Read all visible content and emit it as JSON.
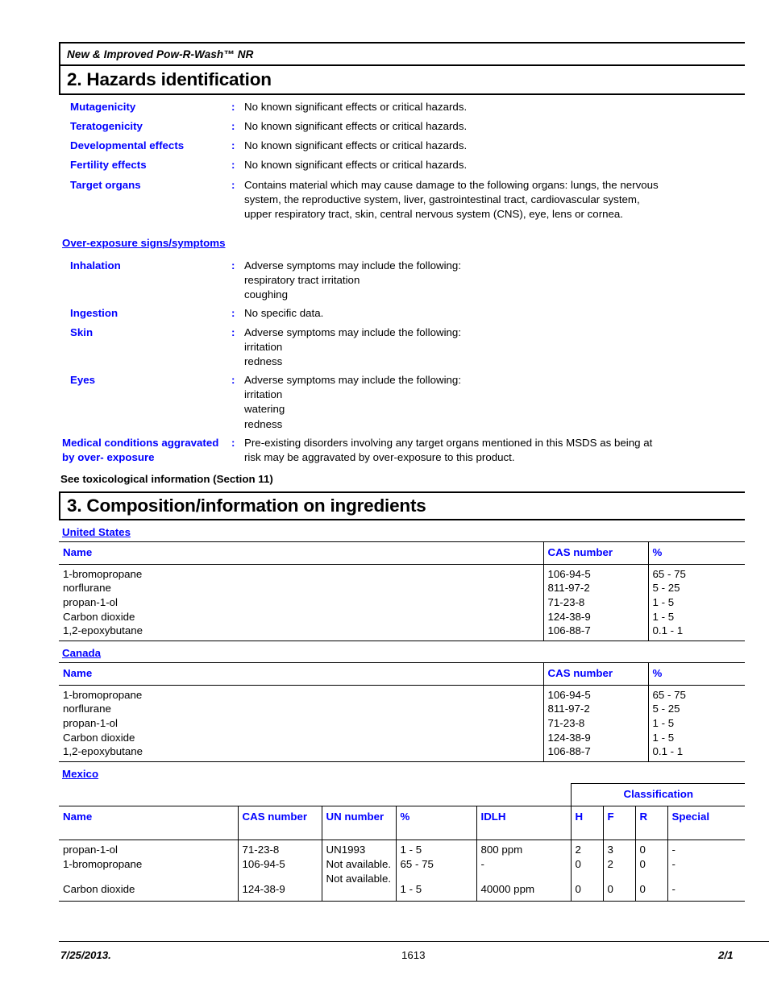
{
  "header": {
    "product_title": "New & Improved Pow-R-Wash™ NR"
  },
  "section2": {
    "title": "2. Hazards identification",
    "colon": ":",
    "rows": [
      {
        "label": "Mutagenicity",
        "lines": [
          "No known significant effects or critical hazards."
        ]
      },
      {
        "label": "Teratogenicity",
        "lines": [
          "No known significant effects or critical hazards."
        ]
      },
      {
        "label": "Developmental effects",
        "lines": [
          "No known significant effects or critical hazards."
        ]
      },
      {
        "label": "Fertility effects",
        "lines": [
          "No known significant effects or critical hazards."
        ]
      },
      {
        "label": "Target organs",
        "lines": [
          "Contains material which may cause damage to the following organs: lungs, the nervous",
          "system, the reproductive system, liver, gastrointestinal tract, cardiovascular system,",
          "upper respiratory tract, skin, central nervous system (CNS), eye, lens or cornea."
        ]
      }
    ],
    "overexposure_heading": "Over-exposure signs/symptoms",
    "overexposure_rows": [
      {
        "label": "Inhalation",
        "lines": [
          "Adverse symptoms may include the following:",
          "respiratory tract irritation",
          "coughing"
        ]
      },
      {
        "label": "Ingestion",
        "lines": [
          "No specific data."
        ]
      },
      {
        "label": "Skin",
        "lines": [
          "Adverse symptoms may include the following:",
          "irritation",
          "redness"
        ]
      },
      {
        "label": "Eyes",
        "lines": [
          "Adverse symptoms may include the following:",
          "irritation",
          "watering",
          "redness"
        ]
      }
    ],
    "medical_label_lines": [
      "Medical conditions",
      "aggravated by over-",
      "exposure"
    ],
    "medical_lines": [
      "Pre-existing disorders involving any target organs mentioned in this MSDS as being at",
      "risk may be aggravated by over-exposure to this product."
    ],
    "tox_note": "See toxicological information (Section 11)"
  },
  "section3": {
    "title": "3. Composition/information on ingredients",
    "us": {
      "heading": "United States",
      "columns": [
        "Name",
        "CAS number",
        "%"
      ],
      "rows": [
        {
          "name": "1-bromopropane",
          "cas": "106-94-5",
          "pct": "65 - 75"
        },
        {
          "name": "norflurane",
          "cas": "811-97-2",
          "pct": "5 - 25"
        },
        {
          "name": "propan-1-ol",
          "cas": "71-23-8",
          "pct": "1 - 5"
        },
        {
          "name": "Carbon dioxide",
          "cas": "124-38-9",
          "pct": "1 - 5"
        },
        {
          "name": "1,2-epoxybutane",
          "cas": "106-88-7",
          "pct": "0.1 - 1"
        }
      ]
    },
    "canada": {
      "heading": "Canada",
      "columns": [
        "Name",
        "CAS number",
        "%"
      ],
      "rows": [
        {
          "name": "1-bromopropane",
          "cas": "106-94-5",
          "pct": "65 - 75"
        },
        {
          "name": "norflurane",
          "cas": "811-97-2",
          "pct": "5 - 25"
        },
        {
          "name": "propan-1-ol",
          "cas": "71-23-8",
          "pct": "1 - 5"
        },
        {
          "name": "Carbon dioxide",
          "cas": "124-38-9",
          "pct": "1 - 5"
        },
        {
          "name": "1,2-epoxybutane",
          "cas": "106-88-7",
          "pct": "0.1 - 1"
        }
      ]
    },
    "mexico": {
      "heading": "Mexico",
      "group_header": "Classification",
      "columns": [
        "Name",
        "CAS number",
        "UN number",
        "%",
        "IDLH",
        "H",
        "F",
        "R",
        "Special"
      ],
      "rows": [
        {
          "name": "propan-1-ol",
          "cas": "71-23-8",
          "un": "UN1993",
          "pct": "1 - 5",
          "idlh": "800 ppm",
          "h": "2",
          "f": "3",
          "r": "0",
          "special": "-"
        },
        {
          "name": "1-bromopropane",
          "cas": "106-94-5",
          "un": "Not available.",
          "pct": "65 - 75",
          "idlh": "-",
          "h": "0",
          "f": "2",
          "r": "0",
          "special": "-"
        },
        {
          "name": "Carbon dioxide",
          "cas": "124-38-9",
          "un": "Not available.",
          "pct": "1 - 5",
          "idlh": "40000 ppm",
          "h": "0",
          "f": "0",
          "r": "0",
          "special": "-"
        }
      ]
    }
  },
  "footer": {
    "date": "7/25/2013.",
    "doc_number": "1613",
    "page": "2/1"
  },
  "colors": {
    "label_blue": "#0000FF",
    "text_black": "#000000"
  }
}
